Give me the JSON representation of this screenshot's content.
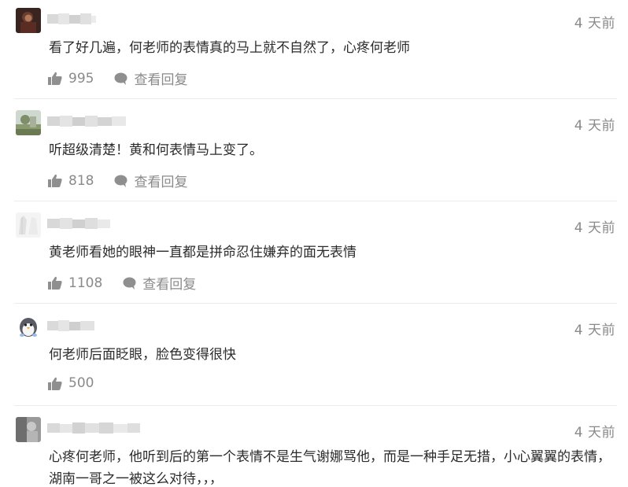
{
  "comments": [
    {
      "time": "4 天前",
      "text": "看了好几遍，何老师的表情真的马上就不自然了，心疼何老师",
      "likes": "995",
      "reply_label": "查看回复",
      "avatar": "dark-portrait"
    },
    {
      "time": "4 天前",
      "text": "听超级清楚！黄和何表情马上变了。",
      "likes": "818",
      "reply_label": "查看回复",
      "avatar": "landscape"
    },
    {
      "time": "4 天前",
      "text": "黄老师看她的眼神一直都是拼命忍住嫌弃的面无表情",
      "likes": "1108",
      "reply_label": "查看回复",
      "avatar": "sketch"
    },
    {
      "time": "4 天前",
      "text": "何老师后面眨眼，脸色变得很快",
      "likes": "500",
      "avatar": "penguin"
    },
    {
      "time": "4 天前",
      "text": "心疼何老师，他听到后的第一个表情不是生气谢娜骂他，而是一种手足无措，小心翼翼的表情，湖南一哥之一被这么对待，，，",
      "avatar": "grey-photo"
    }
  ],
  "icons": {
    "like": "thumbs-up-icon",
    "reply": "speech-bubble-icon"
  },
  "colors": {
    "meta_text": "#8a8a8a",
    "body_text": "#2b2b2b",
    "divider": "#ececec",
    "icon": "#8f8f8f"
  }
}
